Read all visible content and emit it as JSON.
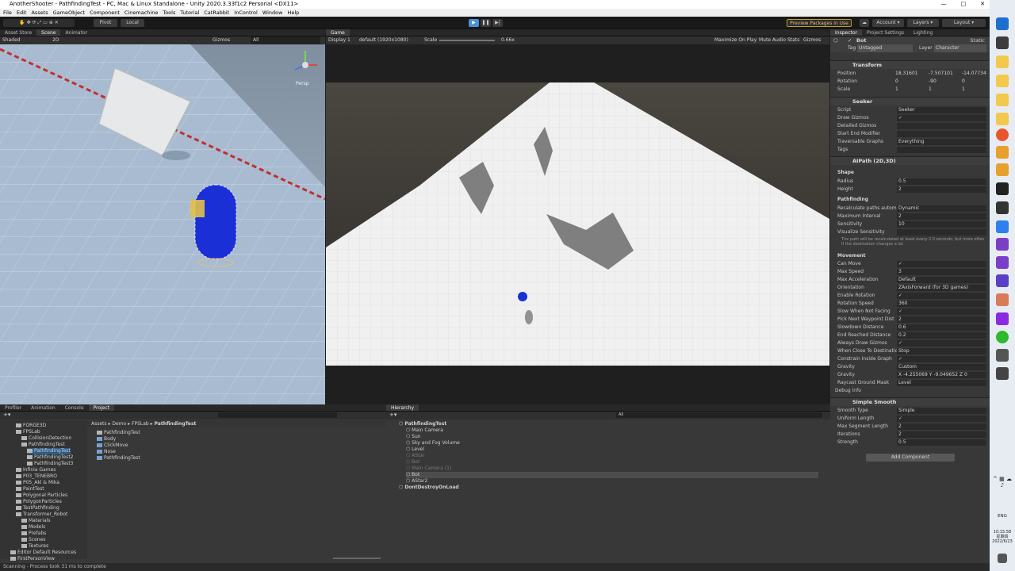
{
  "window": {
    "title": "AnotherShooter - PathfindingTest - PC, Mac & Linux Standalone - Unity 2020.3.33f1c2 Personal <DX11>"
  },
  "menu": [
    "File",
    "Edit",
    "Assets",
    "GameObject",
    "Component",
    "Cinemachine",
    "Tools",
    "Tutorial",
    "CatRabbit",
    "InControl",
    "Window",
    "Help"
  ],
  "toolbar": {
    "pivot": "Pivot",
    "local": "Local",
    "preview_packages": "Preview Packages in Use",
    "account": "Account",
    "layers": "Layers",
    "layout": "Layout"
  },
  "scene_panel": {
    "tabs": [
      "Asset Store",
      "Scene",
      "Animator"
    ],
    "shading": "Shaded",
    "mode": "2D",
    "gizmos": "Gizmos",
    "search": "All",
    "persp": "Persp"
  },
  "game_panel": {
    "tab": "Game",
    "display": "Display 1",
    "resolution": "default (1920x1080)",
    "scale_label": "Scale",
    "scale_value": "0.66x",
    "max_on_play": "Maximize On Play",
    "mute": "Mute Audio",
    "stats": "Stats",
    "gizmos": "Gizmos"
  },
  "inspector": {
    "tabs": [
      "Inspector",
      "Project Settings",
      "Lighting"
    ],
    "object_name": "Bot",
    "static": "Static",
    "tag_label": "Tag",
    "tag": "Untagged",
    "layer_label": "Layer",
    "layer": "Character",
    "transform": {
      "title": "Transform",
      "position": {
        "label": "Position",
        "x": "18.31601",
        "y": "-7.507101",
        "z": "-14.07734"
      },
      "rotation": {
        "label": "Rotation",
        "x": "0",
        "y": "-90",
        "z": "0"
      },
      "scale": {
        "label": "Scale",
        "x": "1",
        "y": "1",
        "z": "1"
      }
    },
    "seeker": {
      "title": "Seeker",
      "rows": [
        {
          "label": "Script",
          "value": "Seeker"
        },
        {
          "label": "Draw Gizmos",
          "value": "✓"
        },
        {
          "label": "Detailed Gizmos",
          "value": ""
        },
        {
          "label": "Start End Modifier",
          "value": ""
        },
        {
          "label": "Traversable Graphs",
          "value": "Everything"
        },
        {
          "label": "Tags",
          "value": ""
        }
      ]
    },
    "aipath": {
      "title": "AIPath (2D,3D)",
      "shape_header": "Shape",
      "shape": [
        {
          "label": "Radius",
          "value": "0.5"
        },
        {
          "label": "Height",
          "value": "2"
        }
      ],
      "pathfinding_header": "Pathfinding",
      "pathfinding": [
        {
          "label": "Recalculate paths autom",
          "value": "Dynamic"
        },
        {
          "label": "Maximum Interval",
          "value": "2"
        },
        {
          "label": "Sensitivity",
          "value": "10"
        },
        {
          "label": "Visualize Sensitivity",
          "value": ""
        }
      ],
      "help": "The path will be recalculated at least every 2.0 seconds, but more often if the destination changes a lot",
      "movement_header": "Movement",
      "movement": [
        {
          "label": "Can Move",
          "value": "✓"
        },
        {
          "label": "Max Speed",
          "value": "3"
        },
        {
          "label": "Max Acceleration",
          "value": "Default"
        },
        {
          "label": "Orientation",
          "value": "ZAxisForward (for 3D games)"
        },
        {
          "label": "Enable Rotation",
          "value": "✓"
        },
        {
          "label": "Rotation Speed",
          "value": "360"
        },
        {
          "label": "Slow When Not Facing",
          "value": "✓"
        },
        {
          "label": "Pick Next Waypoint Dist",
          "value": "2"
        },
        {
          "label": "Slowdown Distance",
          "value": "0.6"
        },
        {
          "label": "End Reached Distance",
          "value": "0.2"
        },
        {
          "label": "Always Draw Gizmos",
          "value": "✓"
        },
        {
          "label": "When Close To Destinatio",
          "value": "Stop"
        },
        {
          "label": "Constrain Inside Graph",
          "value": "✓"
        },
        {
          "label": "Gravity",
          "value": "Custom"
        },
        {
          "label": "Gravity",
          "value": "X -4.255069  Y -9.049652  Z 0"
        },
        {
          "label": "Raycast Ground Mask",
          "value": "Level"
        }
      ],
      "debug": "Debug info"
    },
    "simple_smooth": {
      "title": "Simple Smooth",
      "rows": [
        {
          "label": "Smooth Type",
          "value": "Simple"
        },
        {
          "label": "Uniform Length",
          "value": "✓"
        },
        {
          "label": "Max Segment Length",
          "value": "2"
        },
        {
          "label": "Iterations",
          "value": "2"
        },
        {
          "label": "Strength",
          "value": "0.5"
        }
      ]
    },
    "add_component": "Add Component"
  },
  "bottom_tabs": [
    "Profiler",
    "Animation",
    "Console",
    "Project"
  ],
  "project": {
    "breadcrumb": [
      "Assets",
      "Demo",
      "FPSLab",
      "PathfindingTest"
    ],
    "tree": [
      "FORGE3D",
      "FPSLab",
      "CollisionDetection",
      "PathfindingTest",
      "PathfindingTest",
      "PathfindingTest2",
      "PathfindingTest3",
      "Infinia Games",
      "P03_TENEBRO",
      "P05_Akl & Mika",
      "PaintTest",
      "Polygonal Particles",
      "PolygonParticles",
      "TestPathfinding",
      "Transformer_Robot",
      "Materials",
      "Models",
      "Prefabs",
      "Scenes",
      "Textures",
      "Editor Default Resources",
      "FirstPersonView"
    ],
    "files": [
      "PathfindingTest",
      "Body",
      "ClickMove",
      "Nose",
      "PathfindingTest"
    ]
  },
  "hierarchy": {
    "tab": "Hierarchy",
    "search": "All",
    "items": [
      "PathfindingTest",
      "Main Camera",
      "Sun",
      "Sky and Fog Volume",
      "Level",
      "AStar",
      "Bot",
      "Main Camera (1)",
      "Bot",
      "AStar2",
      "DontDestroyOnLoad"
    ]
  },
  "status": "Scanning - Process took 31 ms to complete",
  "taskbar": {
    "lang": "ENG",
    "time": "10:15:58",
    "day": "星期四",
    "date": "2022/6/23"
  },
  "colors": {
    "play_accent": "#4a90d9",
    "scene_sky": "#9fb4cc",
    "bot_blue": "#1a2fd6",
    "preview_border": "#c49a2c"
  }
}
